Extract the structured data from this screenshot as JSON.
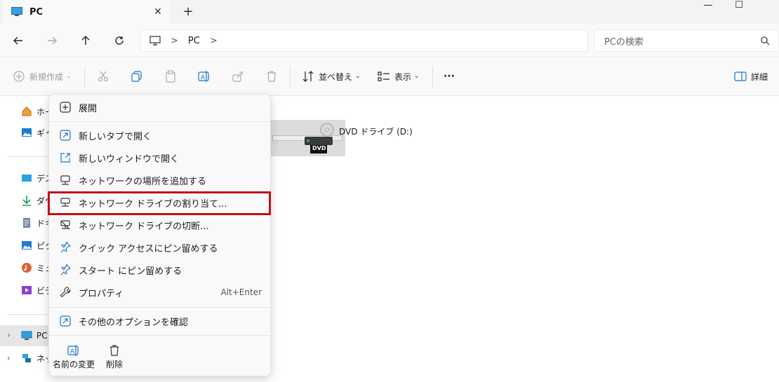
{
  "tab": {
    "title": "PC",
    "close": "✕",
    "new_tab": "+"
  },
  "window_controls": {
    "minimize": "—",
    "maximize": "☐"
  },
  "address": {
    "root_chevron": ">",
    "segment": "PC",
    "trail_chevron": ">"
  },
  "search": {
    "placeholder": "PCの検索"
  },
  "toolbar": {
    "new_label": "新規作成",
    "sort_label": "並べ替え",
    "view_label": "表示",
    "more_label": "···",
    "details_label": "詳細"
  },
  "sidebar": {
    "items": [
      {
        "label": "ホーム",
        "icon": "home-icon"
      },
      {
        "label": "ギャラリー",
        "icon": "gallery-icon"
      },
      {
        "label": "デスクトップ",
        "icon": "desktop-icon"
      },
      {
        "label": "ダウンロード",
        "icon": "download-icon"
      },
      {
        "label": "ドキュメント",
        "icon": "document-icon"
      },
      {
        "label": "ピクチャ",
        "icon": "picture-icon"
      },
      {
        "label": "ミュージック",
        "icon": "music-icon"
      },
      {
        "label": "ビデオ",
        "icon": "video-icon"
      },
      {
        "label": "PC",
        "icon": "pc-icon"
      },
      {
        "label": "ネットワーク",
        "icon": "network-icon"
      }
    ]
  },
  "content": {
    "dvd_label": "DVD ドライブ (D:)",
    "dvd_badge": "DVD"
  },
  "context_menu": {
    "items": [
      {
        "label": "展開",
        "icon": "expand-icon"
      },
      {
        "label": "新しいタブで開く",
        "icon": "open-new-tab-icon"
      },
      {
        "label": "新しいウィンドウで開く",
        "icon": "open-new-window-icon"
      },
      {
        "label": "ネットワークの場所を追加する",
        "icon": "add-network-location-icon"
      },
      {
        "label": "ネットワーク ドライブの割り当て...",
        "icon": "map-network-drive-icon"
      },
      {
        "label": "ネットワーク ドライブの切断...",
        "icon": "disconnect-network-drive-icon"
      },
      {
        "label": "クイック アクセスにピン留めする",
        "icon": "pin-icon"
      },
      {
        "label": "スタート にピン留めする",
        "icon": "pin-start-icon"
      },
      {
        "label": "プロパティ",
        "icon": "wrench-icon",
        "shortcut": "Alt+Enter"
      },
      {
        "label": "その他のオプションを確認",
        "icon": "more-options-icon"
      }
    ],
    "bottom": {
      "rename_label": "名前の変更",
      "delete_label": "削除"
    }
  },
  "colors": {
    "accent": "#0067c0",
    "highlight_border": "#c0101a",
    "selected_bg": "#e6e6e6"
  }
}
